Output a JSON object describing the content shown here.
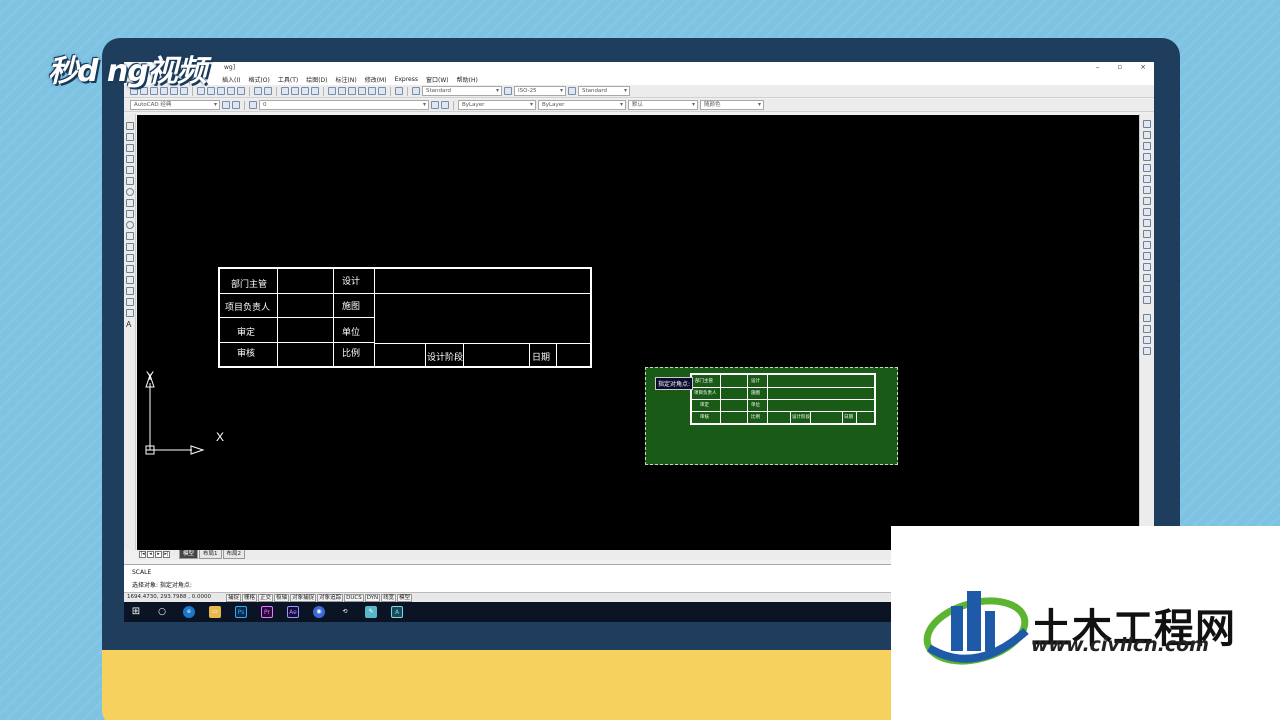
{
  "watermark_logo": "秒d ng视频",
  "window": {
    "title": "wg]",
    "controls": [
      "–",
      "▫",
      "×"
    ]
  },
  "menu": [
    "插入(I)",
    "格式(O)",
    "工具(T)",
    "绘图(D)",
    "标注(N)",
    "修改(M)",
    "Express",
    "窗口(W)",
    "帮助(H)"
  ],
  "toolbar": {
    "text_style": "Standard",
    "dim_style": "ISO-25",
    "table_style": "Standard",
    "workspace": "AutoCAD 经典",
    "layer": "0",
    "color": "ByLayer",
    "linetype": "ByLayer",
    "lineweight": "默认",
    "plot_style": "随颜色"
  },
  "title_block": {
    "rows": [
      {
        "c1": "部门主管",
        "c3": "设计"
      },
      {
        "c1": "项目负责人",
        "c3": "施图"
      },
      {
        "c1": "审定",
        "c3": "单位"
      },
      {
        "c1": "审核",
        "c3": "比例",
        "c5": "设计阶段",
        "c7": "日期"
      }
    ]
  },
  "ucs": {
    "x": "X",
    "y": "Y"
  },
  "selection_tip": "指定对角点:",
  "copy_table": {
    "rows": [
      {
        "c1": "部门主管",
        "c3": "设计"
      },
      {
        "c1": "项目负责人",
        "c3": "施图"
      },
      {
        "c1": "审定",
        "c3": "单位"
      },
      {
        "c1": "审核",
        "c3": "比例",
        "c5": "设计阶段",
        "c7": "日期"
      }
    ]
  },
  "layout_tabs": [
    "模型",
    "布局1",
    "布局2"
  ],
  "command": {
    "history": "SCALE",
    "prompt": "选择对象: 指定对角点:"
  },
  "status": {
    "coords": "1694.4730, 293.7988 , 0.0000",
    "toggles": [
      "捕捉",
      "栅格",
      "正交",
      "极轴",
      "对象捕捉",
      "对象追踪",
      "DUCS",
      "DYN",
      "线宽",
      "模型"
    ]
  },
  "taskbar_apps": [
    "⊞",
    "○",
    "e",
    "▭",
    "Ps",
    "Pr",
    "Ae",
    "◉",
    "⟲",
    "✎",
    "A"
  ],
  "brand": {
    "title": "土木工程网",
    "url": "www.civilcn.com",
    "colors": {
      "blue": "#1e5aa8",
      "green": "#5cb531"
    }
  }
}
